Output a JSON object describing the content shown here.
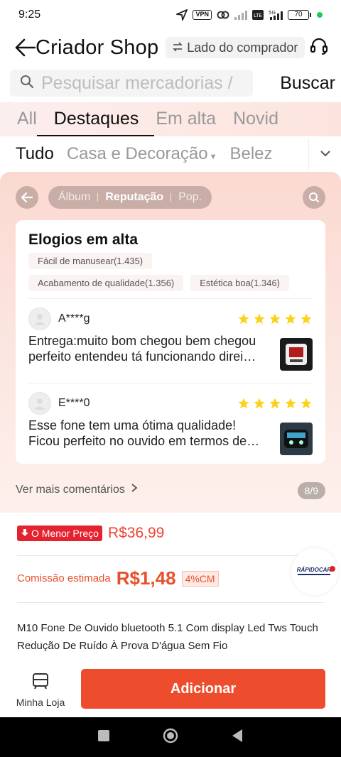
{
  "status": {
    "time": "9:25",
    "vpn": "VPN",
    "battery": "70"
  },
  "header": {
    "title": "Criador Shop",
    "buyer_side": "Lado do comprador"
  },
  "search": {
    "placeholder": "Pesquisar mercadorias /",
    "button": "Buscar"
  },
  "tabs": [
    {
      "label": "All",
      "active": false
    },
    {
      "label": "Destaques",
      "active": true
    },
    {
      "label": "Em alta",
      "active": false
    },
    {
      "label": "Novid",
      "active": false
    }
  ],
  "categories": [
    {
      "label": "Tudo"
    },
    {
      "label": "Casa e Decoração"
    },
    {
      "label": "Belez"
    }
  ],
  "review_nav": {
    "album": "Álbum",
    "reputation": "Reputação",
    "popular": "Pop."
  },
  "praise": {
    "title": "Elogios em alta",
    "chips": [
      "Fácil de manusear(1.435)",
      "Acabamento de qualidade(1.356)",
      "Estética boa(1.346)"
    ]
  },
  "reviews": [
    {
      "user": "A****g",
      "stars": 5,
      "text": "Entrega:muito bom chegou bem chegou perfeito entendeu tá funcionando direi…"
    },
    {
      "user": "E****0",
      "stars": 5,
      "text": "Esse fone tem uma ótima qualidade! Ficou perfeito no ouvido em termos de…"
    }
  ],
  "see_more": "Ver mais comentários",
  "pager": "8/9",
  "product": {
    "lowest_price_badge": "O Menor Preço",
    "price": "R$36,99",
    "commission_label": "Comissão estimada",
    "commission_value": "R$1,48",
    "commission_pct": "4%CM",
    "brand": "RÁPIDOCAR",
    "title": "M10 Fone De Ouvido bluetooth 5.1 Com display Led Tws Touch Redução De Ruído À Prova D'água Sem Fio"
  },
  "bottom": {
    "my_store": "Minha Loja",
    "add": "Adicionar"
  },
  "colors": {
    "accent": "#ee4d2d",
    "star": "#fcd117",
    "badge_red": "#e5222f"
  }
}
